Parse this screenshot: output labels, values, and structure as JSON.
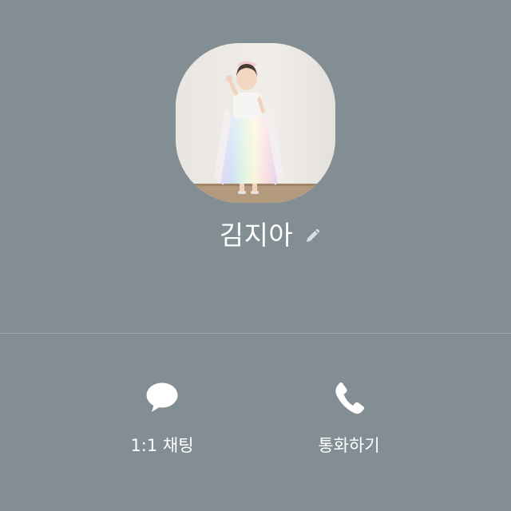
{
  "profile": {
    "name": "김지아",
    "photo": "profile-photo-child-in-rainbow-tulle-dress",
    "edit_icon": "pencil-icon"
  },
  "actions": [
    {
      "label": "1:1 채팅",
      "icon": "chat-bubble-icon"
    },
    {
      "label": "통화하기",
      "icon": "phone-icon"
    }
  ],
  "colors": {
    "background": "#838d94",
    "text": "#ffffff",
    "divider": "#a3abb1",
    "edit_icon": "#d9dde0"
  }
}
